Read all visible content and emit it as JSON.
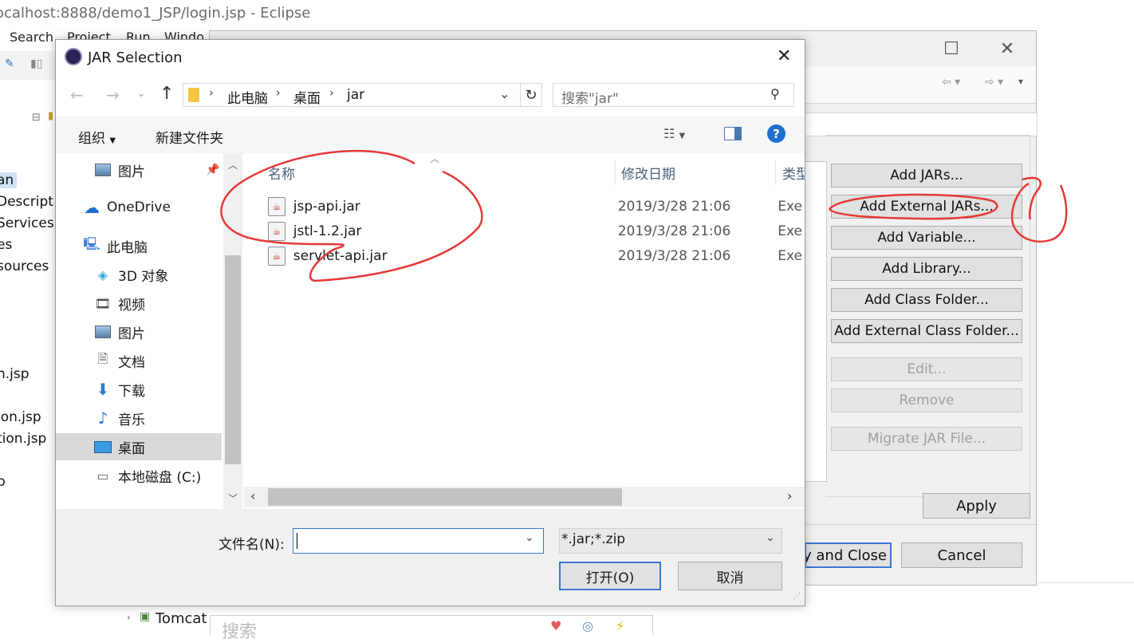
{
  "eclipse": {
    "window_title": "ocalhost:8888/demo1_JSP/login.jsp - Eclipse",
    "menu": [
      "Search",
      "Project",
      "Run",
      "Windo"
    ],
    "tree_items": [
      "an",
      "Descript",
      "Services",
      "es",
      "sources",
      "n.jsp",
      "ion.jsp",
      "tion.jsp",
      "p"
    ],
    "bottom_item": "Tomcat",
    "bottom_search": "搜索"
  },
  "properties": {
    "side_buttons": [
      {
        "label": "Add JARs...",
        "enabled": true
      },
      {
        "label": "Add External JARs...",
        "enabled": true
      },
      {
        "label": "Add Variable...",
        "enabled": true
      },
      {
        "label": "Add Library...",
        "enabled": true
      },
      {
        "label": "Add Class Folder...",
        "enabled": true
      },
      {
        "label": "Add External Class Folder...",
        "enabled": true
      },
      {
        "label": "Edit...",
        "enabled": false
      },
      {
        "label": "Remove",
        "enabled": false
      },
      {
        "label": "Migrate JAR File...",
        "enabled": false
      }
    ],
    "apply_label": "Apply",
    "apply_close_label": "ly and Close",
    "cancel_label": "Cancel"
  },
  "jar_dialog": {
    "title": "JAR Selection",
    "breadcrumb": [
      "此电脑",
      "桌面",
      "jar"
    ],
    "search_placeholder": "搜索\"jar\"",
    "organize_label": "组织",
    "new_folder_label": "新建文件夹",
    "nav_items": [
      {
        "label": "图片",
        "icon": "pictures-icon",
        "pinned": true
      },
      {
        "label": "OneDrive",
        "icon": "onedrive-icon"
      },
      {
        "label": "此电脑",
        "icon": "this-pc-icon"
      },
      {
        "label": "3D 对象",
        "icon": "3d-objects-icon"
      },
      {
        "label": "视频",
        "icon": "videos-icon"
      },
      {
        "label": "图片",
        "icon": "pictures-icon"
      },
      {
        "label": "文档",
        "icon": "documents-icon"
      },
      {
        "label": "下载",
        "icon": "downloads-icon"
      },
      {
        "label": "音乐",
        "icon": "music-icon"
      },
      {
        "label": "桌面",
        "icon": "desktop-icon",
        "selected": true
      },
      {
        "label": "本地磁盘 (C:)",
        "icon": "local-disk-icon"
      }
    ],
    "columns": [
      "名称",
      "修改日期",
      "类型"
    ],
    "files": [
      {
        "name": "jsp-api.jar",
        "date": "2019/3/28 21:06",
        "type": "Exe"
      },
      {
        "name": "jstl-1.2.jar",
        "date": "2019/3/28 21:06",
        "type": "Exe"
      },
      {
        "name": "servlet-api.jar",
        "date": "2019/3/28 21:06",
        "type": "Exe"
      }
    ],
    "filename_label": "文件名(N):",
    "filename_value": "",
    "filter_value": "*.jar;*.zip",
    "open_label": "打开(O)",
    "cancel_label": "取消"
  },
  "annotation_color": "#e53935"
}
